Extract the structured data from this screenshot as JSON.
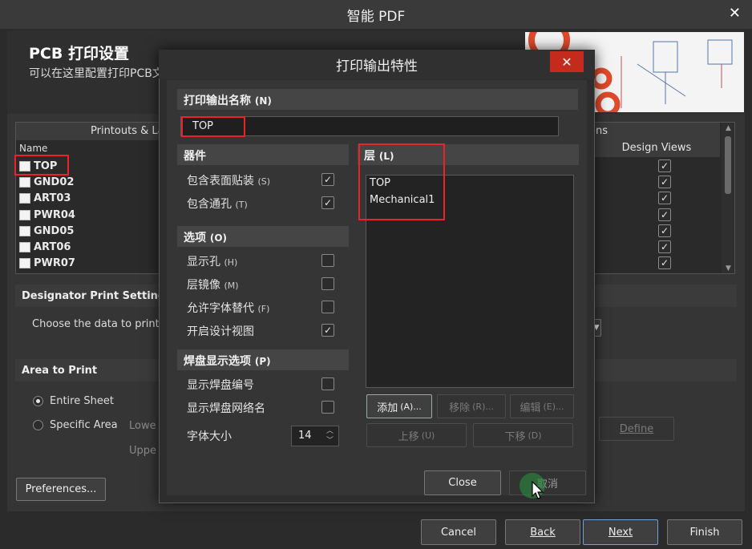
{
  "window": {
    "title": "智能 PDF",
    "close": "✕"
  },
  "header": {
    "title": "PCB 打印设置",
    "subtitle": "可以在这里配置打印PCB文件的打印输出"
  },
  "printouts": {
    "header": "Printouts & Layers",
    "options_header": "ons",
    "name_col": "Name",
    "design_views_col": "Design Views",
    "rows": [
      {
        "name": "TOP",
        "checked": true
      },
      {
        "name": "GND02",
        "checked": true
      },
      {
        "name": "ART03",
        "checked": true
      },
      {
        "name": "PWR04",
        "checked": true
      },
      {
        "name": "GND05",
        "checked": true
      },
      {
        "name": "ART06",
        "checked": true
      },
      {
        "name": "PWR07",
        "checked": true
      }
    ]
  },
  "designator": {
    "title": "Designator Print Settings",
    "text": "Choose the data to print"
  },
  "area": {
    "title": "Area to Print",
    "entire": "Entire Sheet",
    "specific": "Specific Area",
    "lower": "Lowe",
    "upper": "Uppe",
    "define": "Define"
  },
  "preferences": "Preferences...",
  "nav": {
    "cancel": "Cancel",
    "back": "Back",
    "next": "Next",
    "finish": "Finish"
  },
  "modal": {
    "title": "打印输出特性",
    "close": "✕",
    "name_section": "打印输出名称",
    "name_hotkey": "(N)",
    "name_value": "TOP",
    "components": {
      "title": "器件",
      "items": [
        {
          "label": "包含表面贴装",
          "hk": "(S)",
          "checked": true
        },
        {
          "label": "包含通孔",
          "hk": "(T)",
          "checked": true
        }
      ]
    },
    "options": {
      "title": "选项",
      "hk": "(O)",
      "items": [
        {
          "label": "显示孔",
          "hk": "(H)",
          "checked": false
        },
        {
          "label": "层镜像",
          "hk": "(M)",
          "checked": false
        },
        {
          "label": "允许字体替代",
          "hk": "(F)",
          "checked": false
        },
        {
          "label": "开启设计视图",
          "hk": "",
          "checked": true
        }
      ]
    },
    "pad": {
      "title": "焊盘显示选项",
      "hk": "(P)",
      "items": [
        {
          "label": "显示焊盘编号",
          "checked": false
        },
        {
          "label": "显示焊盘网络名",
          "checked": false
        }
      ],
      "font_label": "字体大小",
      "font_value": "14"
    },
    "layers": {
      "title": "层",
      "hk": "(L)",
      "items": [
        "TOP",
        "Mechanical1"
      ]
    },
    "buttons": {
      "add": "添加",
      "add_hk": "(A)...",
      "remove": "移除",
      "remove_hk": "(R)...",
      "edit": "编辑",
      "edit_hk": "(E)...",
      "up": "上移",
      "up_hk": "(U)",
      "down": "下移",
      "down_hk": "(D)",
      "close": "Close",
      "cancel": "取消"
    }
  }
}
